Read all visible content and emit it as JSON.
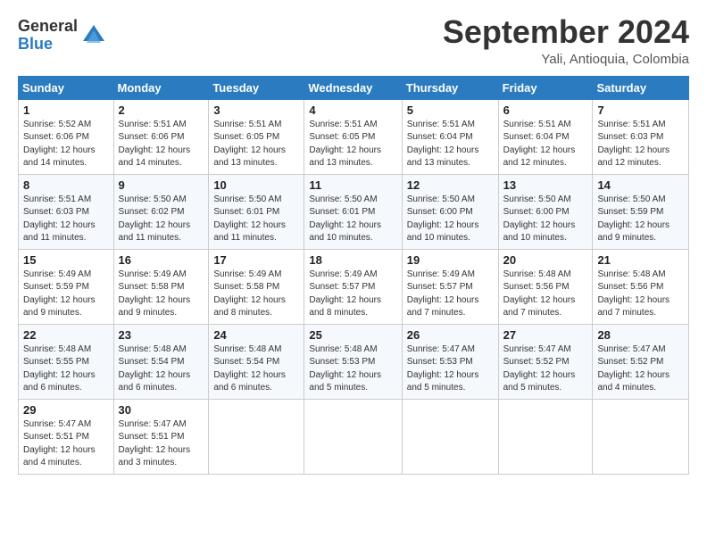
{
  "logo": {
    "general": "General",
    "blue": "Blue"
  },
  "title": "September 2024",
  "location": "Yali, Antioquia, Colombia",
  "days_of_week": [
    "Sunday",
    "Monday",
    "Tuesday",
    "Wednesday",
    "Thursday",
    "Friday",
    "Saturday"
  ],
  "weeks": [
    [
      {
        "day": "1",
        "rise": "5:52 AM",
        "set": "6:06 PM",
        "daylight": "12 hours and 14 minutes."
      },
      {
        "day": "2",
        "rise": "5:51 AM",
        "set": "6:06 PM",
        "daylight": "12 hours and 14 minutes."
      },
      {
        "day": "3",
        "rise": "5:51 AM",
        "set": "6:05 PM",
        "daylight": "12 hours and 13 minutes."
      },
      {
        "day": "4",
        "rise": "5:51 AM",
        "set": "6:05 PM",
        "daylight": "12 hours and 13 minutes."
      },
      {
        "day": "5",
        "rise": "5:51 AM",
        "set": "6:04 PM",
        "daylight": "12 hours and 13 minutes."
      },
      {
        "day": "6",
        "rise": "5:51 AM",
        "set": "6:04 PM",
        "daylight": "12 hours and 12 minutes."
      },
      {
        "day": "7",
        "rise": "5:51 AM",
        "set": "6:03 PM",
        "daylight": "12 hours and 12 minutes."
      }
    ],
    [
      {
        "day": "8",
        "rise": "5:51 AM",
        "set": "6:03 PM",
        "daylight": "12 hours and 11 minutes."
      },
      {
        "day": "9",
        "rise": "5:50 AM",
        "set": "6:02 PM",
        "daylight": "12 hours and 11 minutes."
      },
      {
        "day": "10",
        "rise": "5:50 AM",
        "set": "6:01 PM",
        "daylight": "12 hours and 11 minutes."
      },
      {
        "day": "11",
        "rise": "5:50 AM",
        "set": "6:01 PM",
        "daylight": "12 hours and 10 minutes."
      },
      {
        "day": "12",
        "rise": "5:50 AM",
        "set": "6:00 PM",
        "daylight": "12 hours and 10 minutes."
      },
      {
        "day": "13",
        "rise": "5:50 AM",
        "set": "6:00 PM",
        "daylight": "12 hours and 10 minutes."
      },
      {
        "day": "14",
        "rise": "5:50 AM",
        "set": "5:59 PM",
        "daylight": "12 hours and 9 minutes."
      }
    ],
    [
      {
        "day": "15",
        "rise": "5:49 AM",
        "set": "5:59 PM",
        "daylight": "12 hours and 9 minutes."
      },
      {
        "day": "16",
        "rise": "5:49 AM",
        "set": "5:58 PM",
        "daylight": "12 hours and 9 minutes."
      },
      {
        "day": "17",
        "rise": "5:49 AM",
        "set": "5:58 PM",
        "daylight": "12 hours and 8 minutes."
      },
      {
        "day": "18",
        "rise": "5:49 AM",
        "set": "5:57 PM",
        "daylight": "12 hours and 8 minutes."
      },
      {
        "day": "19",
        "rise": "5:49 AM",
        "set": "5:57 PM",
        "daylight": "12 hours and 7 minutes."
      },
      {
        "day": "20",
        "rise": "5:48 AM",
        "set": "5:56 PM",
        "daylight": "12 hours and 7 minutes."
      },
      {
        "day": "21",
        "rise": "5:48 AM",
        "set": "5:56 PM",
        "daylight": "12 hours and 7 minutes."
      }
    ],
    [
      {
        "day": "22",
        "rise": "5:48 AM",
        "set": "5:55 PM",
        "daylight": "12 hours and 6 minutes."
      },
      {
        "day": "23",
        "rise": "5:48 AM",
        "set": "5:54 PM",
        "daylight": "12 hours and 6 minutes."
      },
      {
        "day": "24",
        "rise": "5:48 AM",
        "set": "5:54 PM",
        "daylight": "12 hours and 6 minutes."
      },
      {
        "day": "25",
        "rise": "5:48 AM",
        "set": "5:53 PM",
        "daylight": "12 hours and 5 minutes."
      },
      {
        "day": "26",
        "rise": "5:47 AM",
        "set": "5:53 PM",
        "daylight": "12 hours and 5 minutes."
      },
      {
        "day": "27",
        "rise": "5:47 AM",
        "set": "5:52 PM",
        "daylight": "12 hours and 5 minutes."
      },
      {
        "day": "28",
        "rise": "5:47 AM",
        "set": "5:52 PM",
        "daylight": "12 hours and 4 minutes."
      }
    ],
    [
      {
        "day": "29",
        "rise": "5:47 AM",
        "set": "5:51 PM",
        "daylight": "12 hours and 4 minutes."
      },
      {
        "day": "30",
        "rise": "5:47 AM",
        "set": "5:51 PM",
        "daylight": "12 hours and 3 minutes."
      },
      null,
      null,
      null,
      null,
      null
    ]
  ]
}
